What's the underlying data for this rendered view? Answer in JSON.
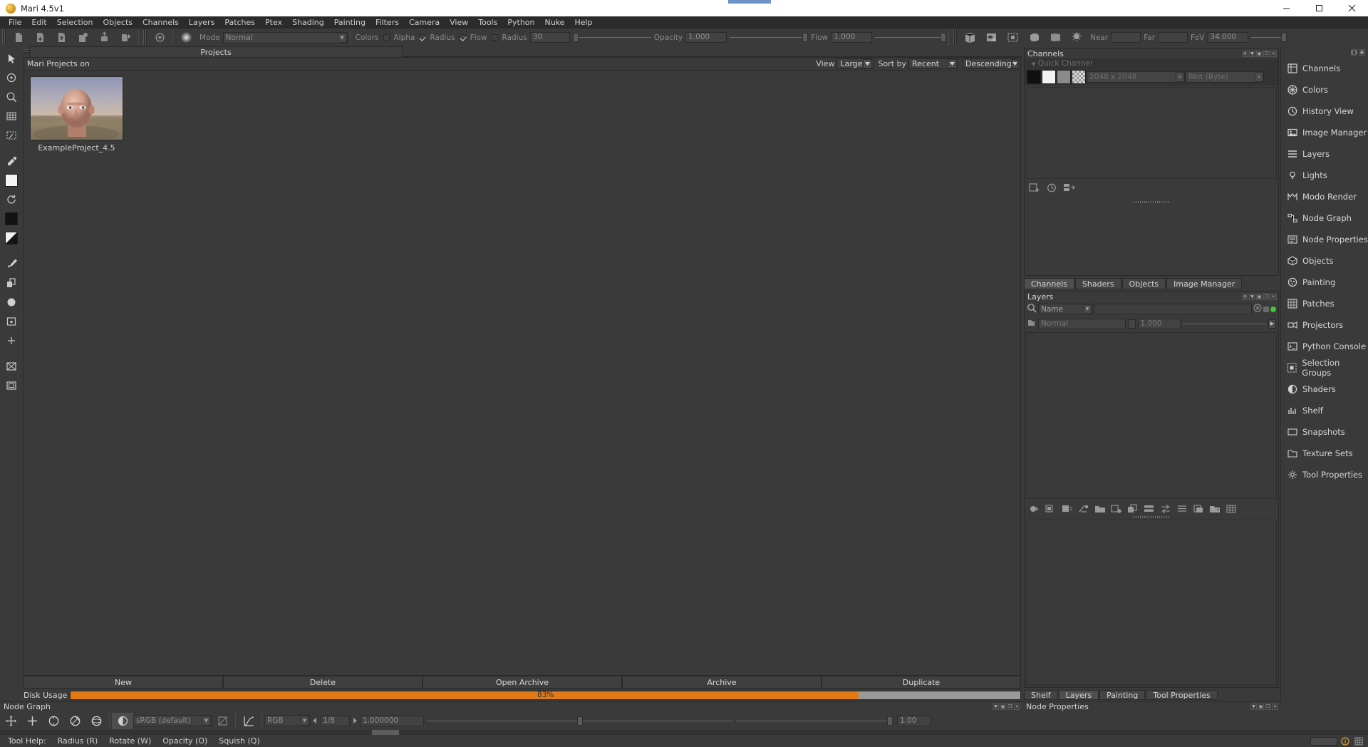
{
  "window": {
    "title": "Mari 4.5v1",
    "icon": "mari-logo-icon",
    "minimize": "—",
    "maximize": "❐",
    "close": "✕"
  },
  "menubar": {
    "items": [
      "File",
      "Edit",
      "Selection",
      "Objects",
      "Channels",
      "Layers",
      "Patches",
      "Ptex",
      "Shading",
      "Painting",
      "Filters",
      "Camera",
      "View",
      "Tools",
      "Python",
      "Nuke",
      "Help"
    ]
  },
  "toolbar": {
    "file_buttons": [
      "new-project-icon",
      "open-project-icon",
      "save-project-icon",
      "import-icon",
      "export-icon",
      "share-icon"
    ],
    "brush_buttons": [
      "brush-add-icon",
      "brush-blur-icon"
    ],
    "mode_label": "Mode",
    "mode_value": "Normal",
    "colors_label": "Colors",
    "alpha_label": "Alpha",
    "radius_label": "Radius",
    "flow_label": "Flow",
    "radius_field_label": "Radius",
    "radius_value": "30",
    "opacity_label": "Opacity",
    "opacity_value": "1.000",
    "flow_field_label": "Flow",
    "flow_value": "1.000",
    "view_buttons": [
      "wireframe-icon",
      "uv-view-icon",
      "selection-icon",
      "shaded-icon",
      "flat-icon",
      "light-icon"
    ],
    "near_label": "Near",
    "near_value": "",
    "far_label": "Far",
    "far_value": "",
    "fov_label": "FoV",
    "fov_value": "34.000"
  },
  "tools": {
    "items": [
      "select-arrow-icon",
      "transform-icon",
      "zoom-icon",
      "grid-icon",
      "marquee-icon",
      "eyedropper-icon",
      "color-swatch-white-icon",
      "rotate-icon",
      "color-swatch-black-icon",
      "gradient-icon",
      "paint-icon",
      "clone-icon",
      "ellipse-icon",
      "square-icon",
      "cross-icon",
      "mask-icon",
      "frame-icon"
    ]
  },
  "projects": {
    "tab_label": "Projects",
    "header_label": "Mari Projects on",
    "view_label": "View",
    "view_value": "Large",
    "sort_label": "Sort by",
    "sort_value": "Recent",
    "order_value": "Descending",
    "items": [
      {
        "name": "ExampleProject_4.5",
        "thumbnail": "bald-head-portrait-desert"
      }
    ],
    "buttons": [
      "New",
      "Delete",
      "Open Archive",
      "Archive",
      "Duplicate"
    ],
    "disk_usage_label": "Disk Usage",
    "disk_usage_percent": 83,
    "disk_usage_text": "83%"
  },
  "channels_palette": {
    "title": "Channels",
    "quick_channel_label": "Quick Channel",
    "resolution_value": "2048 x 2048",
    "depth_value": "8bit (Byte)",
    "swatches": [
      "#111111",
      "#f2f2f2",
      "#8a8a8a",
      "checker"
    ],
    "action_icons": [
      "add-channel-icon",
      "refresh-channel-icon",
      "merge-channel-icon"
    ],
    "tabs": [
      "Channels",
      "Shaders",
      "Objects",
      "Image Manager"
    ],
    "active_tab": "Channels"
  },
  "layers_palette": {
    "title": "Layers",
    "search_icon": "search-icon",
    "filter_value": "Name",
    "filter_placeholder": "",
    "blend_value": "Normal",
    "opacity_value": "1.000",
    "toolbar_icons": [
      "add-paint-layer-icon",
      "add-procedural-icon",
      "add-adjustment-icon",
      "add-mask-icon",
      "add-group-icon",
      "add-channel-layer-icon",
      "duplicate-layer-icon",
      "merge-layer-icon",
      "transfer-icon",
      "stack-icon",
      "copy-layer-icon",
      "move-layer-icon",
      "grid-layer-icon"
    ],
    "tabs": [
      "Shelf",
      "Layers",
      "Painting",
      "Tool Properties"
    ],
    "active_tab": "Layers"
  },
  "palette_bar": {
    "items": [
      {
        "label": "Channels",
        "icon": "channels-icon"
      },
      {
        "label": "Colors",
        "icon": "colors-icon"
      },
      {
        "label": "History View",
        "icon": "history-icon"
      },
      {
        "label": "Image Manager",
        "icon": "image-manager-icon"
      },
      {
        "label": "Layers",
        "icon": "layers-icon"
      },
      {
        "label": "Lights",
        "icon": "lights-icon"
      },
      {
        "label": "Modo Render",
        "icon": "modo-render-icon"
      },
      {
        "label": "Node Graph",
        "icon": "node-graph-icon"
      },
      {
        "label": "Node Properties",
        "icon": "node-properties-icon"
      },
      {
        "label": "Objects",
        "icon": "objects-icon"
      },
      {
        "label": "Painting",
        "icon": "painting-icon"
      },
      {
        "label": "Patches",
        "icon": "patches-icon"
      },
      {
        "label": "Projectors",
        "icon": "projectors-icon"
      },
      {
        "label": "Python Console",
        "icon": "python-console-icon"
      },
      {
        "label": "Selection Groups",
        "icon": "selection-groups-icon"
      },
      {
        "label": "Shaders",
        "icon": "shaders-icon"
      },
      {
        "label": "Shelf",
        "icon": "shelf-icon"
      },
      {
        "label": "Snapshots",
        "icon": "snapshots-icon"
      },
      {
        "label": "Texture Sets",
        "icon": "texture-sets-icon"
      },
      {
        "label": "Tool Properties",
        "icon": "tool-properties-icon"
      }
    ]
  },
  "node_graph": {
    "title": "Node Graph"
  },
  "node_properties": {
    "title": "Node Properties"
  },
  "bottom_toolbar": {
    "transform_icons": [
      "pan-icon",
      "move-icon",
      "rotate-icon",
      "scale-icon",
      "orbit-icon"
    ],
    "colorspace_icon": "colorspace-icon",
    "colorspace_value": "sRGB (default)",
    "gamma_icon": "gamma-icon",
    "curve_icon": "curve-icon",
    "channel_value": "RGB",
    "frame_prev_icon": "prev-frame-icon",
    "frame_value": "1/8",
    "frame_next_icon": "next-frame-icon",
    "exposure_value": "1.000000",
    "zoom_value": "1.00"
  },
  "statusbar": {
    "help_label": "Tool Help:",
    "hints": [
      "Radius (R)",
      "Rotate (W)",
      "Opacity (O)",
      "Squish (Q)"
    ]
  },
  "colors": {
    "accent_orange": "#e07b16",
    "panel_bg": "#3a3a3a",
    "dark_bg": "#2b2b2b",
    "text": "#d2d2d2",
    "dim_text": "#8a8a8a"
  }
}
